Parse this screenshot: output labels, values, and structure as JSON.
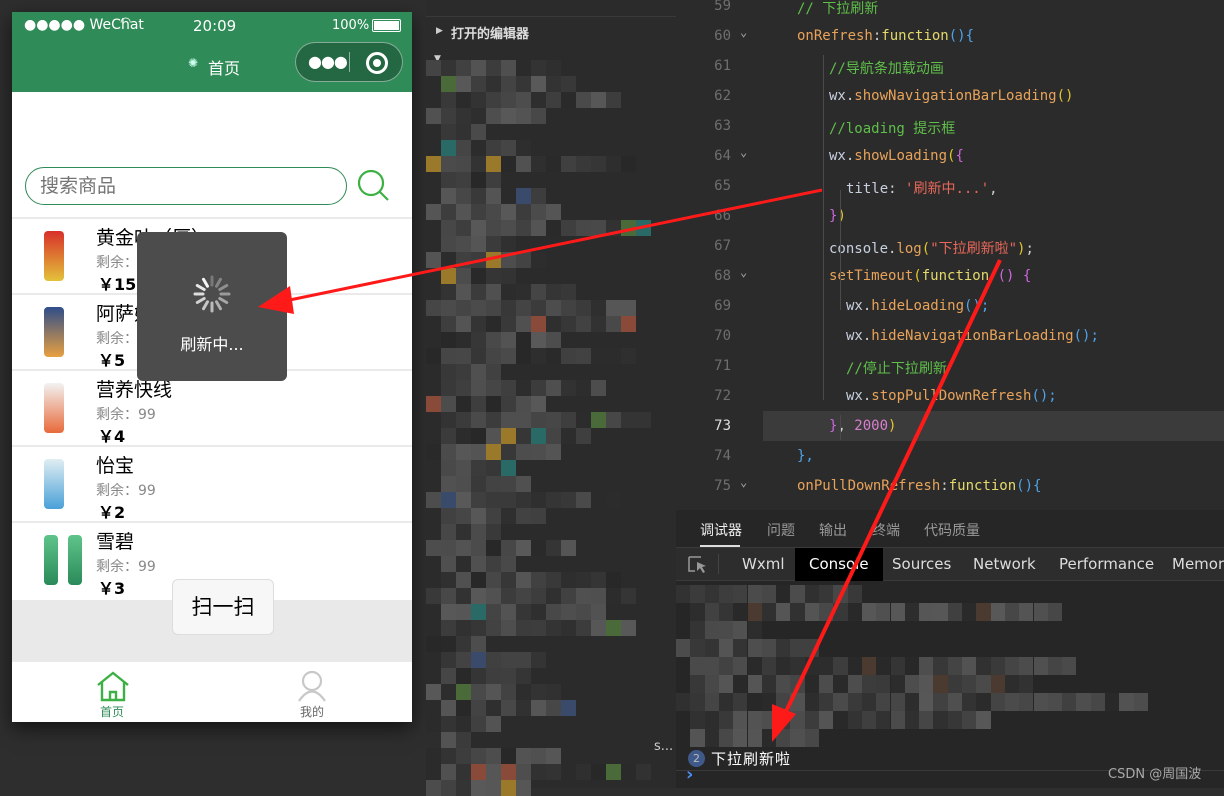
{
  "phone": {
    "status": {
      "carrier": "●●●●● WeChat",
      "time": "20:09",
      "battery": "100%"
    },
    "nav_title": "首页",
    "search_placeholder": "搜索商品",
    "products": [
      {
        "name": "黄金叶（厚）",
        "stock": "剩余：99",
        "price": "￥15"
      },
      {
        "name": "阿萨姆",
        "stock": "剩余：99",
        "price": "￥5"
      },
      {
        "name": "营养快线",
        "stock": "剩余：99",
        "price": "￥4"
      },
      {
        "name": "怡宝",
        "stock": "剩余：99",
        "price": "￥2"
      },
      {
        "name": "雪碧",
        "stock": "剩余：99",
        "price": "￥3"
      }
    ],
    "scan_label": "扫一扫",
    "toast_text": "刷新中...",
    "tabs": [
      {
        "label": "首页",
        "icon": "home-icon",
        "active": true
      },
      {
        "label": "我的",
        "icon": "user-icon",
        "active": false
      }
    ],
    "accent": "#2f8b57"
  },
  "explorer": {
    "section": "打开的编辑器",
    "truncated": "s..."
  },
  "editor": {
    "active_line": 73,
    "lines": [
      {
        "n": 59,
        "fold": false,
        "indent": 0,
        "tokens": [
          {
            "t": "// 下拉刷新",
            "c": "comment"
          }
        ]
      },
      {
        "n": 60,
        "fold": true,
        "indent": 0,
        "tokens": [
          {
            "t": "onRefresh",
            "c": "prop"
          },
          {
            "t": ":",
            "c": "punc"
          },
          {
            "t": "function",
            "c": "kw"
          },
          {
            "t": "(){",
            "c": "brace"
          }
        ]
      },
      {
        "n": 61,
        "fold": false,
        "indent": 1,
        "tokens": [
          {
            "t": "//导航条加载动画",
            "c": "comment"
          }
        ]
      },
      {
        "n": 62,
        "fold": false,
        "indent": 1,
        "tokens": [
          {
            "t": "wx",
            "c": "obj"
          },
          {
            "t": ".",
            "c": "punc"
          },
          {
            "t": "showNavigationBarLoading",
            "c": "method"
          },
          {
            "t": "()",
            "c": "brace2"
          }
        ]
      },
      {
        "n": 63,
        "fold": false,
        "indent": 1,
        "tokens": [
          {
            "t": "//loading 提示框",
            "c": "comment"
          }
        ]
      },
      {
        "n": 64,
        "fold": true,
        "indent": 1,
        "tokens": [
          {
            "t": "wx",
            "c": "obj"
          },
          {
            "t": ".",
            "c": "punc"
          },
          {
            "t": "showLoading",
            "c": "method"
          },
          {
            "t": "(",
            "c": "brace2"
          },
          {
            "t": "{",
            "c": "brace3"
          }
        ]
      },
      {
        "n": 65,
        "fold": false,
        "indent": 2,
        "tokens": [
          {
            "t": "title",
            "c": "obj"
          },
          {
            "t": ": ",
            "c": "punc"
          },
          {
            "t": "'刷新中...'",
            "c": "str"
          },
          {
            "t": ",",
            "c": "punc"
          }
        ]
      },
      {
        "n": 66,
        "fold": false,
        "indent": 1,
        "tokens": [
          {
            "t": "}",
            "c": "brace3"
          },
          {
            "t": ")",
            "c": "brace2"
          }
        ]
      },
      {
        "n": 67,
        "fold": false,
        "indent": 1,
        "tokens": [
          {
            "t": "console",
            "c": "obj"
          },
          {
            "t": ".",
            "c": "punc"
          },
          {
            "t": "log",
            "c": "method"
          },
          {
            "t": "(",
            "c": "brace2"
          },
          {
            "t": "\"下拉刷新啦\"",
            "c": "str"
          },
          {
            "t": ")",
            "c": "brace2"
          },
          {
            "t": ";",
            "c": "punc"
          }
        ]
      },
      {
        "n": 68,
        "fold": true,
        "indent": 1,
        "tokens": [
          {
            "t": "setTimeout",
            "c": "method"
          },
          {
            "t": "(",
            "c": "brace2"
          },
          {
            "t": "function",
            "c": "kw"
          },
          {
            "t": " () {",
            "c": "brace3"
          }
        ]
      },
      {
        "n": 69,
        "fold": false,
        "indent": 2,
        "tokens": [
          {
            "t": "wx",
            "c": "obj"
          },
          {
            "t": ".",
            "c": "punc"
          },
          {
            "t": "hideLoading",
            "c": "method"
          },
          {
            "t": "();",
            "c": "brace"
          }
        ]
      },
      {
        "n": 70,
        "fold": false,
        "indent": 2,
        "tokens": [
          {
            "t": "wx",
            "c": "obj"
          },
          {
            "t": ".",
            "c": "punc"
          },
          {
            "t": "hideNavigationBarLoading",
            "c": "method"
          },
          {
            "t": "();",
            "c": "brace"
          }
        ]
      },
      {
        "n": 71,
        "fold": false,
        "indent": 2,
        "tokens": [
          {
            "t": "//停止下拉刷新",
            "c": "comment"
          }
        ]
      },
      {
        "n": 72,
        "fold": false,
        "indent": 2,
        "tokens": [
          {
            "t": "wx",
            "c": "obj"
          },
          {
            "t": ".",
            "c": "punc"
          },
          {
            "t": "stopPullDownRefresh",
            "c": "method"
          },
          {
            "t": "();",
            "c": "brace"
          }
        ]
      },
      {
        "n": 73,
        "fold": false,
        "indent": 1,
        "tokens": [
          {
            "t": "}",
            "c": "brace3"
          },
          {
            "t": ", ",
            "c": "punc"
          },
          {
            "t": "2000",
            "c": "num"
          },
          {
            "t": ")",
            "c": "brace2"
          }
        ]
      },
      {
        "n": 74,
        "fold": false,
        "indent": 0,
        "tokens": [
          {
            "t": "},",
            "c": "brace"
          }
        ]
      },
      {
        "n": 75,
        "fold": true,
        "indent": 0,
        "tokens": [
          {
            "t": "onPullDownRefresh",
            "c": "prop"
          },
          {
            "t": ":",
            "c": "punc"
          },
          {
            "t": "function",
            "c": "kw"
          },
          {
            "t": "(){",
            "c": "brace"
          }
        ]
      }
    ]
  },
  "panel": {
    "tabs": [
      "调试器",
      "问题",
      "输出",
      "终端",
      "代码质量"
    ],
    "devtools_tabs": [
      "Wxml",
      "Console",
      "Sources",
      "Network",
      "Performance",
      "Memory"
    ],
    "active_devtool": "Console",
    "log_count": "2",
    "log_message": "下拉刷新啦",
    "prompt": "›",
    "watermark": "CSDN @周国波"
  }
}
